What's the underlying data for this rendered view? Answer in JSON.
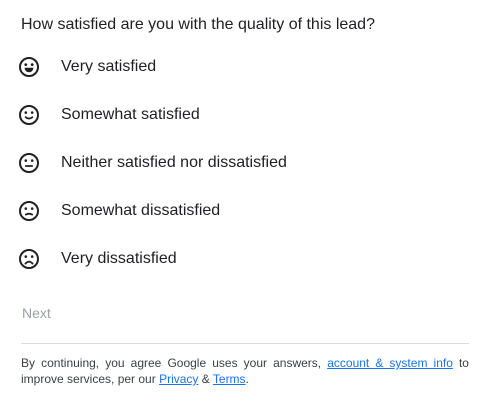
{
  "survey": {
    "question": "How satisfied are you with the quality of this lead?",
    "options": [
      {
        "label": "Very satisfied",
        "icon": "very-happy-face-icon"
      },
      {
        "label": "Somewhat satisfied",
        "icon": "slight-smile-face-icon"
      },
      {
        "label": "Neither satisfied nor dissatisfied",
        "icon": "neutral-face-icon"
      },
      {
        "label": "Somewhat dissatisfied",
        "icon": "slight-frown-face-icon"
      },
      {
        "label": "Very dissatisfied",
        "icon": "sad-face-icon"
      }
    ],
    "next_label": "Next"
  },
  "footer": {
    "text_before": "By continuing, you agree Google uses your answers,",
    "account_link": "account & system info",
    "text_middle": "to improve services, per our",
    "privacy_link": "Privacy",
    "amp": "&",
    "terms_link": "Terms",
    "period": "."
  },
  "colors": {
    "text": "#202124",
    "disabled": "#9aa0a6",
    "link": "#1a73e8",
    "divider": "#dadce0"
  }
}
